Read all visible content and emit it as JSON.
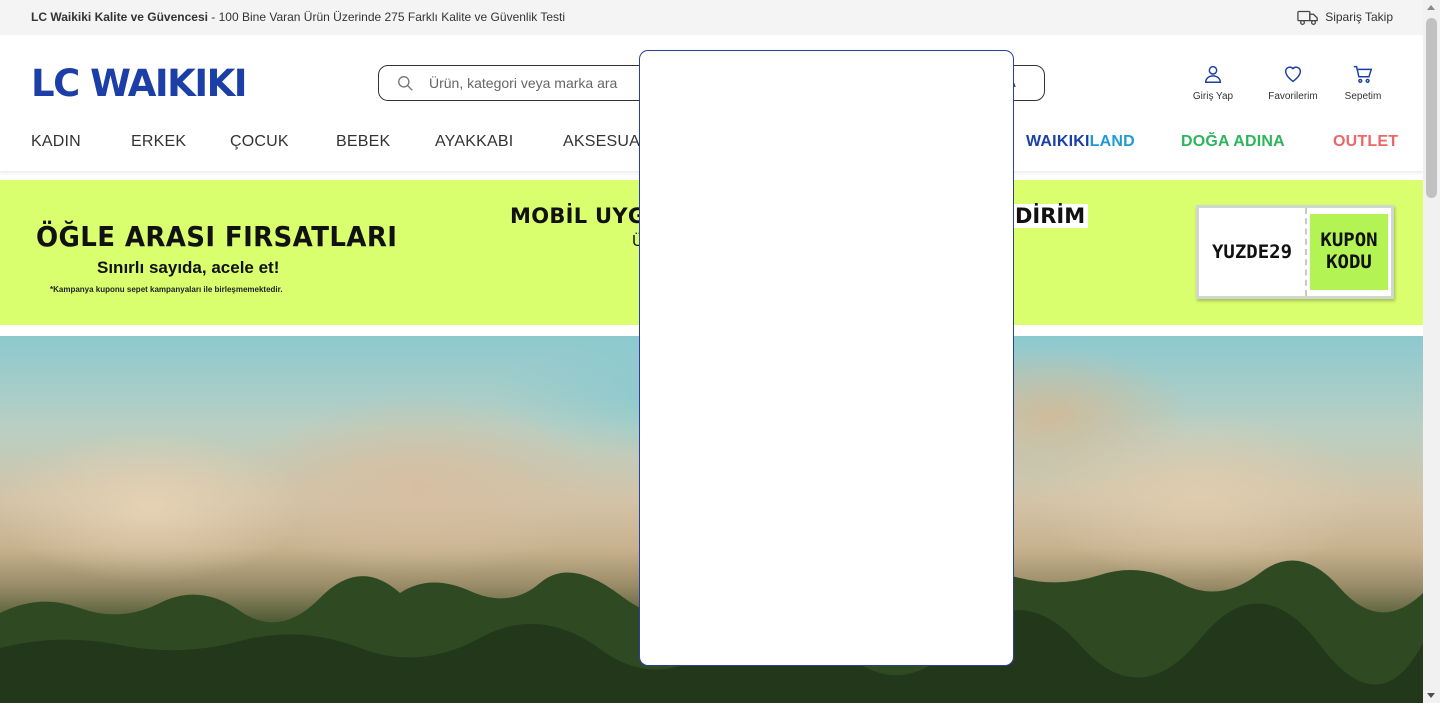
{
  "topbar": {
    "promo_bold": "LC Waikiki Kalite ve Güvencesi",
    "promo_rest": " - 100 Bine Varan Ürün Üzerinde 275 Farklı Kalite ve Güvenlik Testi",
    "order_tracking": "Sipariş Takip"
  },
  "header": {
    "logo": "LC WAIKIKI",
    "search_placeholder": "Ürün, kategori veya marka ara",
    "search_button_fragment": "A",
    "icons": [
      {
        "label": "Giriş Yap",
        "icon": "user-icon"
      },
      {
        "label": "Favorilerim",
        "icon": "heart-icon"
      },
      {
        "label": "Sepetim",
        "icon": "cart-icon"
      }
    ]
  },
  "nav": {
    "items": [
      "KADIN",
      "ERKEK",
      "ÇOCUK",
      "BEBEK",
      "AYAKKABI",
      "AKSESUAR"
    ],
    "waikikiland_part1": "WAIKIKI",
    "waikikiland_part2": "LAND",
    "doga": "DOĞA ADINA",
    "outlet": "OUTLET"
  },
  "banner": {
    "title": "ÖĞLE ARASI FIRSATLARI",
    "subtitle": "Sınırlı sayıda, acele et!",
    "note": "*Kampanya kuponu sepet kampanyaları ile birleşmemektedir.",
    "middle_line1": "MOBİL UYGU",
    "middle_line2": "Ü",
    "right_fragment": "DİRİM",
    "coupon_code": "YUZDE29",
    "coupon_label_1": "KUPON",
    "coupon_label_2": "KODU"
  },
  "hero": {
    "script_text": "",
    "image": "landscape-with-dust-clouds"
  },
  "modal": {
    "state": "empty"
  },
  "colors": {
    "brand_blue": "#1c3fa7",
    "banner_green": "#d9fe6e",
    "coupon_green": "#b3f354",
    "doga_green": "#2db55d",
    "outlet_red": "#ef6666",
    "land_blue": "#1e9bd7"
  }
}
